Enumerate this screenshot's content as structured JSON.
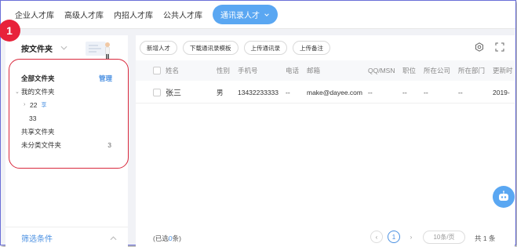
{
  "top_tabs": [
    {
      "label": "企业人才库"
    },
    {
      "label": "高级人才库"
    },
    {
      "label": "内招人才库"
    },
    {
      "label": "公共人才库"
    },
    {
      "label": "通讯录人才"
    }
  ],
  "left_panel": {
    "header": "按文件夹",
    "callout_number": "1",
    "tree": {
      "all_folders": "全部文件夹",
      "manage": "管理",
      "my_folders": "我的文件夹",
      "folder_22": "22",
      "folder_22_badge": "享",
      "folder_33": "33",
      "shared_folders": "共享文件夹",
      "uncategorized": "未分类文件夹",
      "uncategorized_count": "3"
    },
    "filter_label": "筛选条件"
  },
  "toolbar": {
    "add_talent": "新增人才",
    "download_template": "下载通讯录模板",
    "upload_contacts": "上传通讯录",
    "upload_notes": "上传备注"
  },
  "table": {
    "columns": [
      "姓名",
      "性别",
      "手机号",
      "电话",
      "邮箱",
      "QQ/MSN",
      "职位",
      "所在公司",
      "所在部门",
      "更新时"
    ],
    "rows": [
      [
        "张三",
        "男",
        "13432233333",
        "--",
        "make@dayee.com",
        "--",
        "--",
        "--",
        "--",
        "2019-"
      ]
    ]
  },
  "footer": {
    "selected_prefix": "(已选",
    "selected_count": "0",
    "selected_suffix": "条)",
    "prev": "‹",
    "current_page": "1",
    "next": "›",
    "page_size": "10条/页",
    "total": "共 1 条"
  },
  "colors": {
    "accent": "#5aa7f2",
    "link": "#4a90e2",
    "callout": "#e8223a",
    "frame_border": "#6a6fd8"
  }
}
